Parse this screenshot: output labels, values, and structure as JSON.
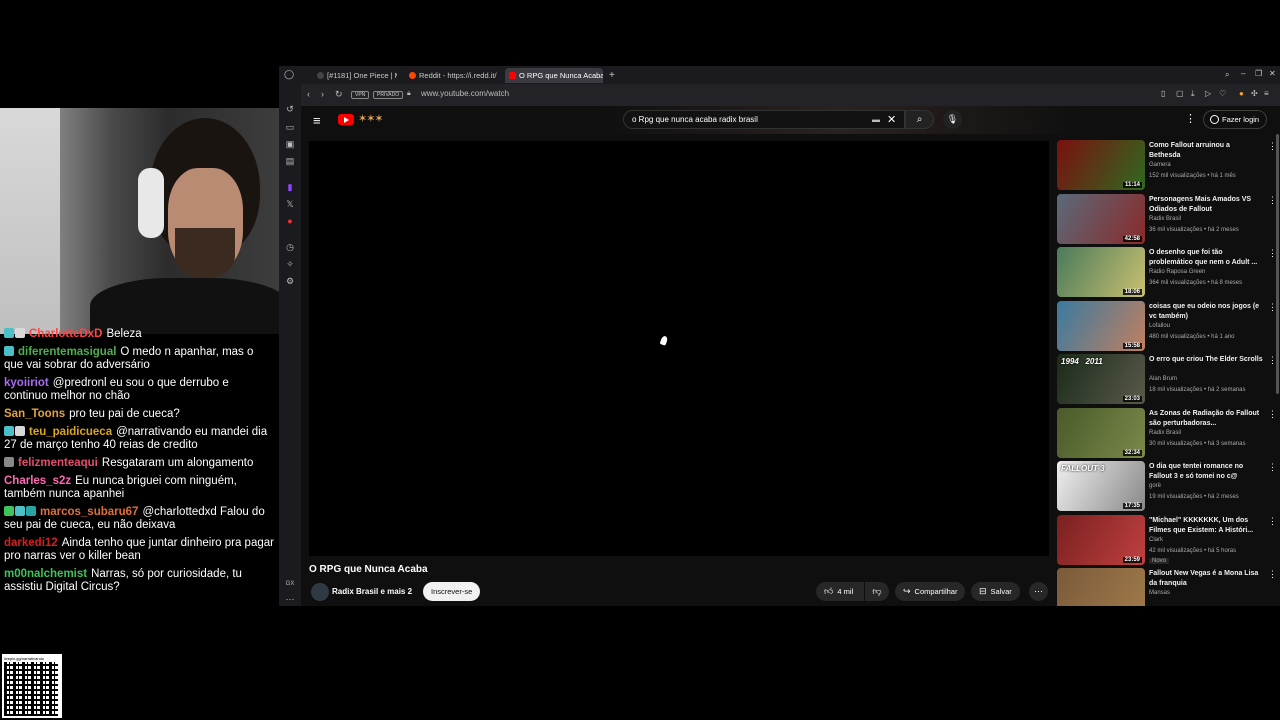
{
  "browser": {
    "tabs": [
      {
        "label": "[#1181] One Piece | MANG"
      },
      {
        "label": "Reddit - https://i.redd.it/"
      },
      {
        "label": "O RPG que Nunca Acaba"
      }
    ],
    "new_tab": "+",
    "address": "www.youtube.com/watch",
    "vpn_label": "VPN",
    "private_label": "PRIVADO"
  },
  "youtube": {
    "search_value": "o Rpg que nunca acaba radix brasil",
    "login_label": "Fazer login",
    "video_title": "O RPG que Nunca Acaba",
    "channel": "Radix Brasil e mais 2",
    "subscribe_label": "Inscrever-se",
    "likes": "4 mil",
    "share_label": "Compartilhar",
    "save_label": "Salvar",
    "recommendations": [
      {
        "title": "Como Fallout arruinou a Bethesda",
        "channel": "Gamera",
        "meta": "152 mil visualizações • há 1 mês",
        "duration": "11:14",
        "colors": [
          "#7a1010",
          "#2f6a1f"
        ]
      },
      {
        "title": "Personagens Mais Amados VS Odiados de Fallout",
        "channel": "Radix Brasil",
        "meta": "36 mil visualizações • há 2 meses",
        "duration": "42:58",
        "colors": [
          "#5a6a7a",
          "#8a2a2a"
        ]
      },
      {
        "title": "O desenho que foi tão problemático que nem o Adult ...",
        "channel": "Radio Raposa Green",
        "meta": "364 mil visualizações • há 8 meses",
        "duration": "18:06",
        "colors": [
          "#4a7a5a",
          "#c9c070"
        ]
      },
      {
        "title": "coisas que eu odeio nos jogos (e vc também)",
        "channel": "Lofallou",
        "meta": "480 mil visualizações • há 1 ano",
        "duration": "15:58",
        "colors": [
          "#3a7aa0",
          "#c08060"
        ]
      },
      {
        "title": "O erro que criou The Elder Scrolls",
        "channel": "Alan Brum",
        "meta": "18 mil visualizações • há 2 semanas",
        "duration": "23:03",
        "colors": [
          "#1a2a1a",
          "#5a5a4a"
        ],
        "thumb_text": "1994   2011"
      },
      {
        "title": "As Zonas de Radiação do Fallout são perturbadoras...",
        "channel": "Radix Brasil",
        "meta": "30 mil visualizações • há 3 semanas",
        "duration": "32:34",
        "colors": [
          "#4a5a2a",
          "#7a8a4a"
        ]
      },
      {
        "title": "O dia que tentei romance no Fallout 3 e só tomei no c@",
        "channel": "gorë",
        "meta": "19 mil visualizações • há 2 meses",
        "duration": "17:35",
        "colors": [
          "#f0f0f0",
          "#888888"
        ],
        "thumb_text": "FALLOUT 3"
      },
      {
        "title": "\"Michael\" KKKKKKK, Um dos Filmes que Existem: A Históri...",
        "channel": "Clark",
        "meta": "42 mil visualizações • há 5 horas",
        "duration": "23:59",
        "badge": "Novo",
        "colors": [
          "#7a2020",
          "#c04040"
        ]
      },
      {
        "title": "Fallout New Vegas é a Mona Lisa da franquia",
        "channel": "Mansas",
        "meta": "",
        "duration": "",
        "colors": [
          "#7a5a3a",
          "#a07a4a"
        ]
      }
    ]
  },
  "chat": {
    "messages": [
      {
        "user": "CharlotteDxD",
        "color": "#ff4444",
        "text": "Beleza",
        "badges": [
          "#4ac1c9",
          "#d8d8d8"
        ]
      },
      {
        "user": "diferentemasigual",
        "color": "#4caf50",
        "text": "O medo n apanhar, mas o que vai sobrar do adversário",
        "badges": [
          "#4ac1c9"
        ]
      },
      {
        "user": "kyoiiriot",
        "color": "#a86cf0",
        "text": "@predronl eu sou o que derrubo e continuo melhor no chão",
        "badges": []
      },
      {
        "user": "San_Toons",
        "color": "#e6a23c",
        "text": "pro teu pai de cueca?",
        "badges": []
      },
      {
        "user": "teu_paidicueca",
        "color": "#daa520",
        "text": "@narrativando eu mandei dia 27 de março tenho 40 reias de credito",
        "badges": [
          "#4ac1c9",
          "#d8d8d8"
        ]
      },
      {
        "user": "felizmenteaqui",
        "color": "#e34c6c",
        "text": "Resgataram um alongamento",
        "badges": [
          "#888888"
        ]
      },
      {
        "user": "Charles_s2z",
        "color": "#ff69b4",
        "text": "Eu nunca briguei com ninguém, também nunca apanhei",
        "badges": []
      },
      {
        "user": "marcos_subaru67",
        "color": "#e0703a",
        "text": "@charlottedxd Falou do seu pai de cueca, eu não deixava",
        "badges": [
          "#3ec45a",
          "#4ac1c9",
          "#2aa3a3"
        ]
      },
      {
        "user": "darkedi12",
        "color": "#d02020",
        "text": "Ainda tenho que juntar dinheiro pra pagar pro narras ver o killer bean",
        "badges": []
      },
      {
        "user": "m00nalchemist",
        "color": "#43c15a",
        "text": "Narras, só por curiosidade, tu assistiu Digital Circus?",
        "badges": []
      }
    ]
  },
  "qr": {
    "url": "livepix.gg/narrativando"
  }
}
